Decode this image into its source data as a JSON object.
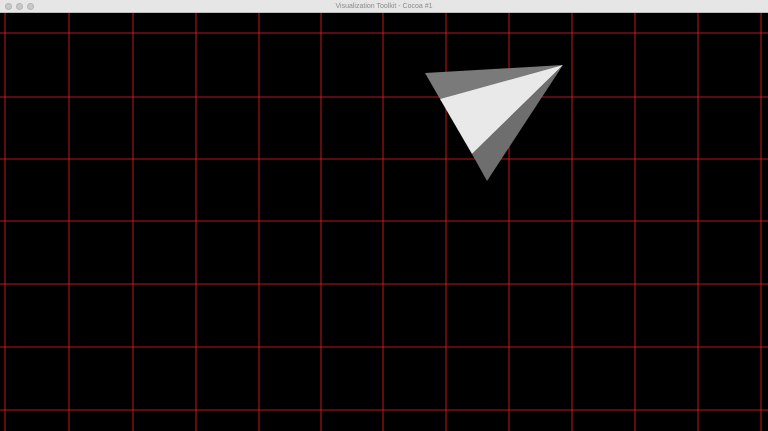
{
  "window": {
    "title": "Visualization Toolkit - Cocoa #1",
    "buttons": [
      "close-button",
      "minimize-button",
      "zoom-button"
    ]
  },
  "scene": {
    "background_color": "#000000",
    "grid_color": "#ff2020",
    "object": "rotated cone/tetrahedron rendered with flat shading",
    "face_colors": {
      "light_face": "#e9e9e9",
      "dark_face_upper": "#7a7a7a",
      "dark_face_lower": "#6e6e6e"
    }
  }
}
